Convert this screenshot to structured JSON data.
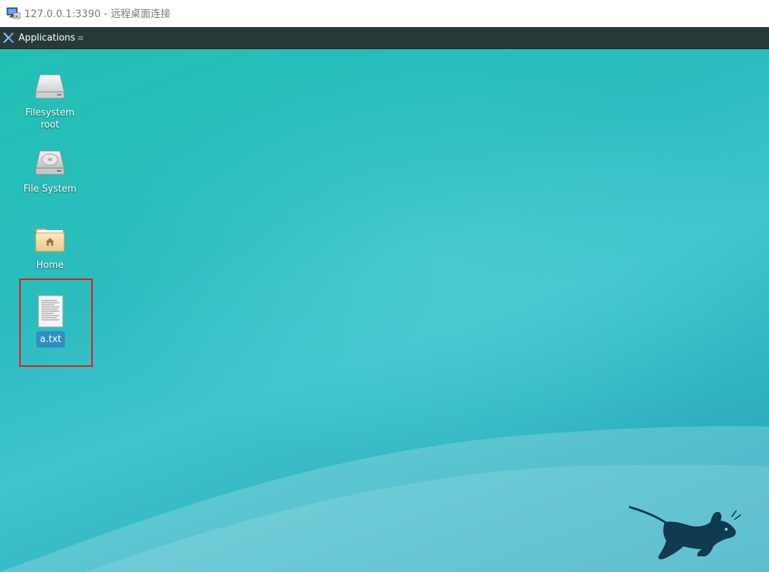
{
  "window": {
    "title": "127.0.0.1:3390 - 远程桌面连接",
    "icon": "remote-desktop-icon"
  },
  "panel": {
    "applications_label": "Applications",
    "applications_icon": "xfce-logo-icon",
    "arrow": "≡"
  },
  "desktop": {
    "icons": [
      {
        "label": "Filesystem root",
        "icon": "drive-icon"
      },
      {
        "label": "File System",
        "icon": "harddisk-icon"
      },
      {
        "label": "Home",
        "icon": "home-folder-icon"
      },
      {
        "label": "a.txt",
        "icon": "text-file-icon",
        "selected": true
      }
    ]
  },
  "colors": {
    "panel_bg": "#28393a",
    "desktop_teal": "#2cbcbf",
    "selection": "#2f8fc4",
    "highlight_border": "#e3171e",
    "mouse_logo": "#0f3a4f"
  }
}
